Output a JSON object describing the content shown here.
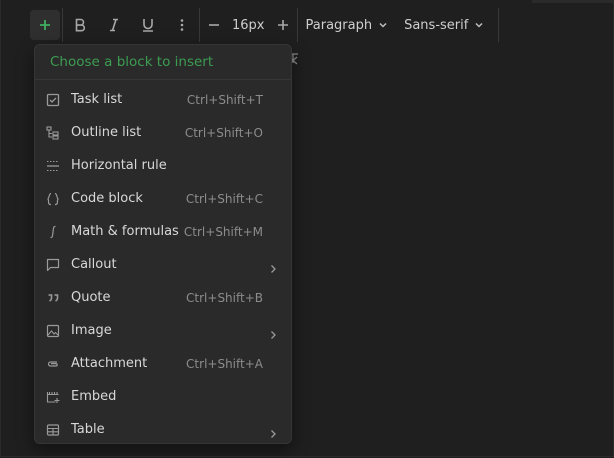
{
  "toolbar": {
    "font_size": "16px",
    "block_type": "Paragraph",
    "font_family": "Sans-serif"
  },
  "menu": {
    "header": "Choose a block to insert",
    "items": [
      {
        "icon": "task-list-icon",
        "label": "Task list",
        "shortcut": "Ctrl+Shift+T",
        "submenu": false
      },
      {
        "icon": "outline-list-icon",
        "label": "Outline list",
        "shortcut": "Ctrl+Shift+O",
        "submenu": false
      },
      {
        "icon": "horizontal-rule-icon",
        "label": "Horizontal rule",
        "shortcut": "",
        "submenu": false
      },
      {
        "icon": "code-block-icon",
        "label": "Code block",
        "shortcut": "Ctrl+Shift+C",
        "submenu": false
      },
      {
        "icon": "math-icon",
        "label": "Math & formulas",
        "shortcut": "Ctrl+Shift+M",
        "submenu": false
      },
      {
        "icon": "callout-icon",
        "label": "Callout",
        "shortcut": "",
        "submenu": true
      },
      {
        "icon": "quote-icon",
        "label": "Quote",
        "shortcut": "Ctrl+Shift+B",
        "submenu": false
      },
      {
        "icon": "image-icon",
        "label": "Image",
        "shortcut": "",
        "submenu": true
      },
      {
        "icon": "attachment-icon",
        "label": "Attachment",
        "shortcut": "Ctrl+Shift+A",
        "submenu": false
      },
      {
        "icon": "embed-icon",
        "label": "Embed",
        "shortcut": "",
        "submenu": false
      },
      {
        "icon": "table-icon",
        "label": "Table",
        "shortcut": "",
        "submenu": true
      }
    ]
  },
  "colors": {
    "accent": "#3fae5f",
    "background": "#1f1f1f",
    "menu_bg": "#2a2a2a"
  }
}
